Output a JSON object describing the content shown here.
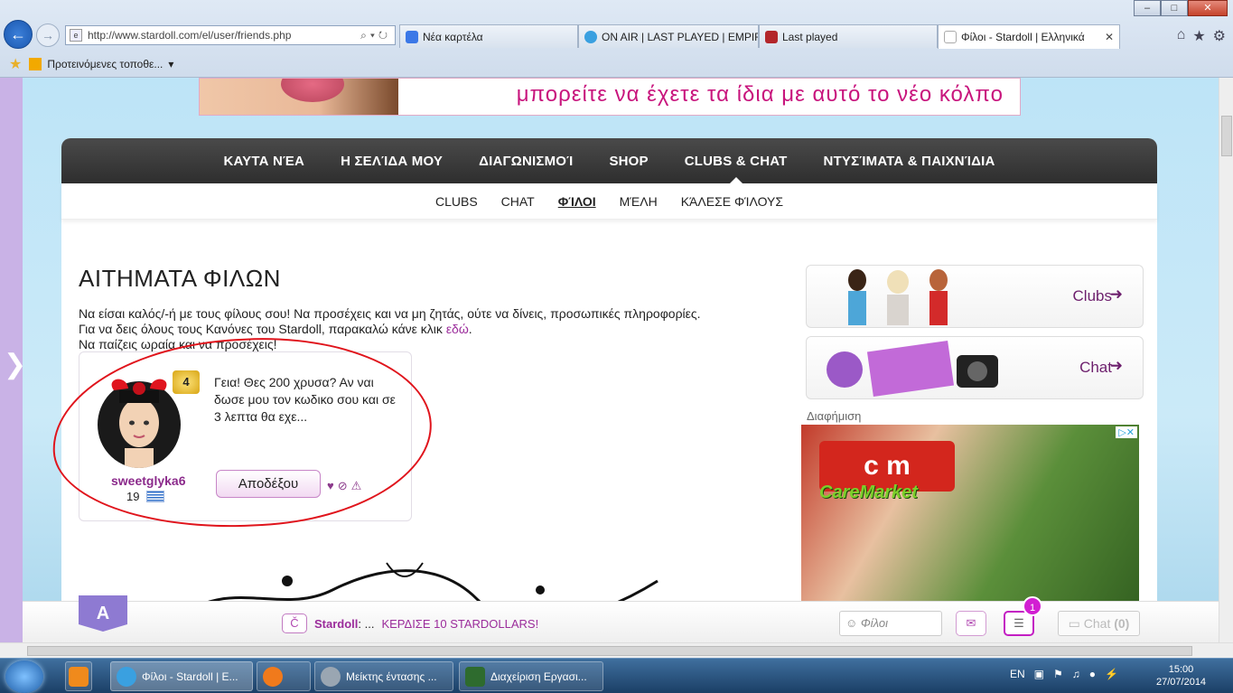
{
  "browser": {
    "url": "http://www.stardoll.com/el/user/friends.php",
    "tabs": [
      {
        "label": "Νέα καρτέλα"
      },
      {
        "label": "ON AIR | LAST PLAYED | EMPIR..."
      },
      {
        "label": "Last played"
      },
      {
        "label": "Φίλοι - Stardoll | Ελληνικά"
      }
    ],
    "favorites_label": "Προτεινόμενες τοποθε...",
    "win_minimize": "–",
    "win_maximize": "□",
    "win_close": "✕"
  },
  "banner": {
    "text": "μπορείτε να έχετε τα ίδια με αυτό το νέο κόλπο"
  },
  "topnav": [
    "ΚΑΥΤΑ ΝΈΑ",
    "Η ΣΕΛΊΔΑ ΜΟΥ",
    "ΔΙΑΓΩΝΙΣΜΟΊ",
    "SHOP",
    "CLUBS & CHAT",
    "ΝΤΥΣΊΜΑΤΑ & ΠΑΙΧΝΊΔΙΑ"
  ],
  "subnav": [
    "CLUBS",
    "CHAT",
    "ΦΊΛΟΙ",
    "ΜΈΛΗ",
    "ΚΆΛΕΣΕ ΦΊΛΟΥΣ"
  ],
  "main": {
    "title": "ΑΙΤΗΜΑΤΑ ΦΙΛΩΝ",
    "rules_line1": "Να είσαι καλός/-ή με τους φίλους σου! Να προσέχεις και να μη ζητάς, ούτε να δίνεις, προσωπικές πληροφορίες.",
    "rules_line2_prefix": "Για να δεις όλους τους Κανόνες του Stardoll, παρακαλώ κάνε κλικ ",
    "rules_link": "εδώ",
    "rules_line2_suffix": ".",
    "rules_line3": "Να παίζεις ωραία και να προσέχεις!"
  },
  "request": {
    "level": "4",
    "username": "sweetglyka6",
    "age": "19",
    "message": "Γεια! Θες 200 χρυσα? Αν ναι δωσε μου τον κωδικο σου και σε 3 λεπτα θα εχε...",
    "accept_label": "Αποδέξου"
  },
  "sidebar": {
    "clubs_label": "Clubs",
    "chat_label": "Chat",
    "arrow": "➜",
    "ad_label": "Διαφήμιση",
    "ad_logo": "c m",
    "ad_brand": "CareMarket",
    "ad_choices": "▷✕"
  },
  "bottombar": {
    "logo": "A",
    "brand": "Stardoll",
    "news_sep": ": ...",
    "promo": "ΚΕΡΔΙΣΕ 10 STARDOLLARS!",
    "friends_placeholder": "Φίλοι",
    "notification_count": "1",
    "chat_label": "Chat",
    "chat_count": "(0)"
  },
  "taskbar": {
    "items": [
      "Φίλοι - Stardoll | E...",
      "",
      "Μείκτης έντασης ...",
      "Διαχείριση Εργασι..."
    ],
    "lang": "EN",
    "time": "15:00",
    "date": "27/07/2014"
  },
  "colors": {
    "accent": "#9b2c9b",
    "nav_dark": "#333333",
    "scribble": "#e0141c"
  }
}
